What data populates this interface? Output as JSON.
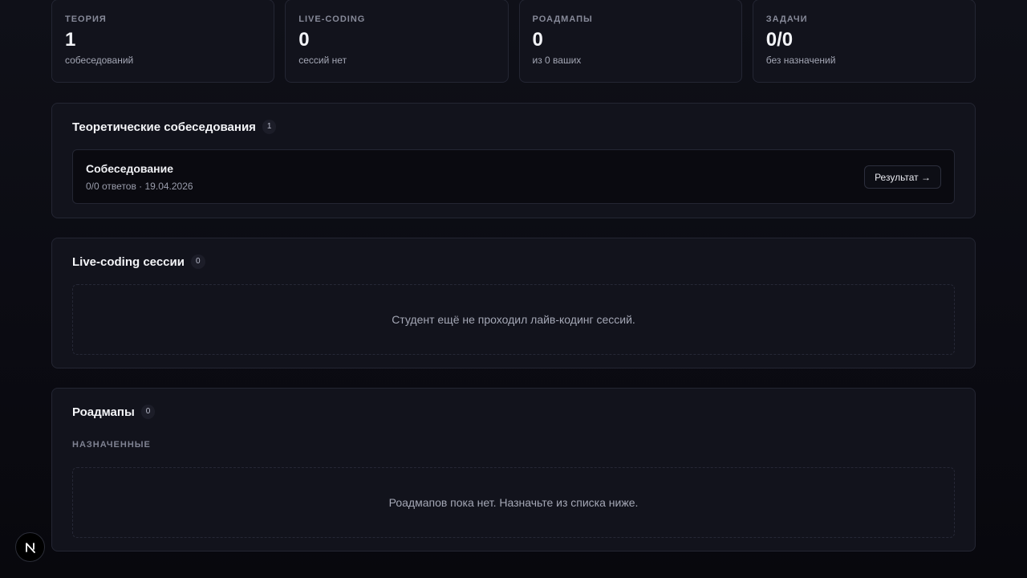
{
  "stats": [
    {
      "label": "ТЕОРИЯ",
      "value": "1",
      "sub": "собеседований"
    },
    {
      "label": "LIVE-CODING",
      "value": "0",
      "sub": "сессий нет"
    },
    {
      "label": "РОАДМАПЫ",
      "value": "0",
      "sub": "из 0 ваших"
    },
    {
      "label": "ЗАДАЧИ",
      "value": "0/0",
      "sub": "без назначений"
    }
  ],
  "theory": {
    "title": "Теоретические собеседования",
    "count": "1",
    "items": [
      {
        "title": "Собеседование",
        "meta": "0/0 ответов · 19.04.2026",
        "button": "Результат →"
      }
    ]
  },
  "livecoding": {
    "title": "Live-coding сессии",
    "count": "0",
    "empty": "Студент ещё не проходил лайв-кодинг сессий."
  },
  "roadmaps": {
    "title": "Роадмапы",
    "count": "0",
    "section_label": "НАЗНАЧЕННЫЕ",
    "empty": "Роадмапов пока нет. Назначьте из списка ниже."
  },
  "dev_badge": {
    "icon": "nextjs-logo-icon",
    "letter": "N"
  }
}
